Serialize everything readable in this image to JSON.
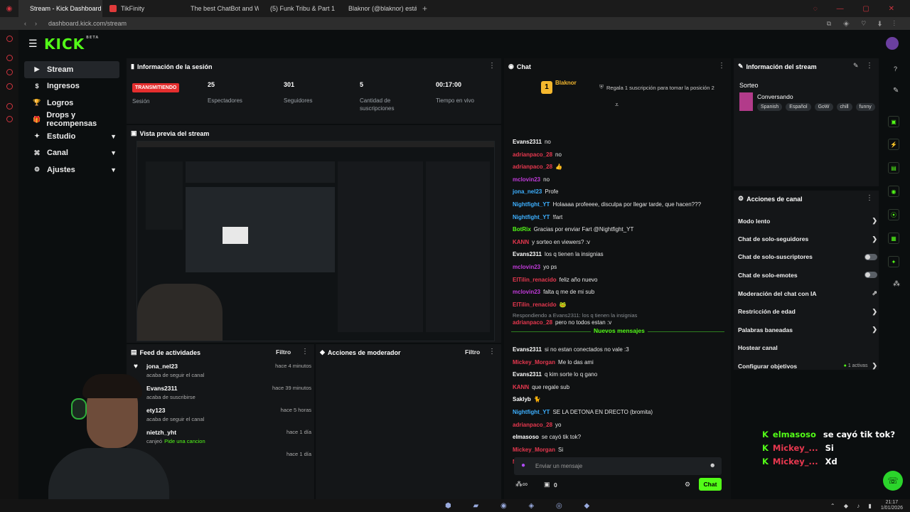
{
  "browser": {
    "tabs": [
      {
        "title": "Stream - Kick Dashboard",
        "color": "#53fc18"
      },
      {
        "title": "TikFinity",
        "color": "#e03a3a"
      },
      {
        "title": "The best ChatBot and Wi",
        "color": "#ffffff"
      },
      {
        "title": "(5) Funk Tribu & Part 1",
        "color": "#e52e2e"
      },
      {
        "title": "Blaknor (@blaknor) está e",
        "color": "#ffffff"
      }
    ],
    "url": "dashboard.kick.com/stream",
    "clock_time": "21:17",
    "clock_date": "1/01/2026"
  },
  "app": {
    "logo": "KICK",
    "logo_sup": "BETA",
    "nav": [
      {
        "label": "Stream",
        "icon": "play-icon",
        "glyph": "▶",
        "chev": ""
      },
      {
        "label": "Ingresos",
        "icon": "dollar-icon",
        "glyph": "$",
        "chev": ""
      },
      {
        "label": "Logros",
        "icon": "trophy-icon",
        "glyph": "🏆",
        "chev": ""
      },
      {
        "label": "Drops y recompensas",
        "icon": "gift-icon",
        "glyph": "🎁",
        "chev": ""
      },
      {
        "label": "Estudio",
        "icon": "studio-icon",
        "glyph": "✦",
        "chev": "▼"
      },
      {
        "label": "Canal",
        "icon": "channel-icon",
        "glyph": "⌘",
        "chev": "▼"
      },
      {
        "label": "Ajustes",
        "icon": "gear-icon",
        "glyph": "⚙",
        "chev": "▼"
      }
    ]
  },
  "session": {
    "title": "Información de la sesión",
    "status": "TRANSMITIENDO",
    "status_label": "Sesión",
    "stats": [
      {
        "value": "25",
        "label": "Espectadores"
      },
      {
        "value": "301",
        "label": "Seguidores"
      },
      {
        "value": "5",
        "label": "Cantidad de suscripciones"
      },
      {
        "value": "00:17:00",
        "label": "Tiempo en vivo"
      }
    ]
  },
  "preview": {
    "title": "Vista previa del stream"
  },
  "feed": {
    "title": "Feed de actividades",
    "filter": "Filtro",
    "items": [
      {
        "user": "jona_nel23",
        "action": "acaba de seguir el canal",
        "time": "hace 4 minutos"
      },
      {
        "user": "Evans2311",
        "action": "acaba de suscribirse",
        "time": "hace 39 minutos"
      },
      {
        "user": "ety123",
        "action": "acaba de seguir el canal",
        "time": "hace 5 horas"
      },
      {
        "user": "nietzh_yht",
        "action": "canjeó",
        "highlight": "Pide una cancion",
        "time": "hace 1 día"
      },
      {
        "user": "",
        "action": "",
        "time": "hace 1 día"
      }
    ]
  },
  "moderator": {
    "title": "Acciones de moderador",
    "filter": "Filtro"
  },
  "chat": {
    "title": "Chat",
    "pinned_user": "Blaknor",
    "pinned_rank": "1",
    "pinned_msg": "Regala 1 suscripción para tomar la posición 2",
    "messages": [
      {
        "user": "Evans2311",
        "color": "#ffffff",
        "text": "no"
      },
      {
        "user": "adrianpaco_28",
        "color": "#e8384f",
        "text": "no"
      },
      {
        "user": "adrianpaco_28",
        "color": "#e8384f",
        "text": "👍"
      },
      {
        "user": "mclovin23",
        "color": "#c23bdb",
        "text": "no"
      },
      {
        "user": "jona_nel23",
        "color": "#3db0ff",
        "text": "Profe"
      },
      {
        "user": "Nightfight_YT",
        "color": "#3db0ff",
        "text": "Holaaaa profeeee, disculpa por llegar tarde, que hacen???"
      },
      {
        "user": "Nightfight_YT",
        "color": "#3db0ff",
        "text": "!fart"
      },
      {
        "user": "BotRix",
        "color": "#53fc18",
        "text": "Gracias por enviar Fart @Nightfight_YT"
      },
      {
        "user": "KANN",
        "color": "#e8384f",
        "text": "y sorteo en viewers? :v"
      },
      {
        "user": "Evans2311",
        "color": "#ffffff",
        "text": "los q tienen la insignias"
      },
      {
        "user": "mclovin23",
        "color": "#c23bdb",
        "text": "yo ps"
      },
      {
        "user": "ElTilin_renacido",
        "color": "#e8384f",
        "text": "feliz año nuevo"
      },
      {
        "user": "mclovin23",
        "color": "#c23bdb",
        "text": "falta q me de mi sub"
      },
      {
        "user": "ElTilin_renacido",
        "color": "#e8384f",
        "text": "🐸"
      }
    ],
    "reply_to": "Respondiendo a Evans2311: los q tienen la insignias",
    "reply_msg": {
      "user": "adrianpaco_28",
      "color": "#e8384f",
      "text": "pero no todos estan :v"
    },
    "new_messages": "Nuevos mensajes",
    "messages2": [
      {
        "user": "Evans2311",
        "color": "#ffffff",
        "text": "si no estan conectados no vale :3"
      },
      {
        "user": "Mickey_Morgan",
        "color": "#e8384f",
        "text": "Me lo das ami"
      },
      {
        "user": "Evans2311",
        "color": "#ffffff",
        "text": "q kim sorte lo q gano"
      },
      {
        "user": "KANN",
        "color": "#e8384f",
        "text": "que regale sub"
      },
      {
        "user": "Saklyb",
        "color": "#ffffff",
        "text": "🐈"
      },
      {
        "user": "Nightfight_YT",
        "color": "#3db0ff",
        "text": "SE LA DETONA EN DRECTO (bromita)"
      },
      {
        "user": "adrianpaco_28",
        "color": "#e8384f",
        "text": "yo"
      },
      {
        "user": "elmasoso",
        "color": "#ffffff",
        "text": "se cayó tik tok?"
      },
      {
        "user": "Mickey_Morgan",
        "color": "#e8384f",
        "text": "Si"
      },
      {
        "user": "Mickey_Morgan",
        "color": "#e8384f",
        "text": "Xd"
      }
    ],
    "input_placeholder": "Enviar un mensaje",
    "points": "0",
    "send_label": "Chat"
  },
  "stream_info": {
    "title": "Información del stream",
    "stream_title": "Sorteo",
    "category": "Conversando",
    "tags": [
      "Spanish",
      "Español",
      "GoW",
      "chill",
      "funny"
    ]
  },
  "channel_actions": {
    "title": "Acciones de canal",
    "items": [
      {
        "label": "Modo lento",
        "kind": "chev"
      },
      {
        "label": "Chat de solo-seguidores",
        "kind": "chev"
      },
      {
        "label": "Chat de solo-suscriptores",
        "kind": "toggle"
      },
      {
        "label": "Chat de solo-emotes",
        "kind": "toggle"
      },
      {
        "label": "Moderación del chat con IA",
        "kind": "ext"
      },
      {
        "label": "Restricción de edad",
        "kind": "chev"
      },
      {
        "label": "Palabras baneadas",
        "kind": "chev"
      },
      {
        "label": "Hostear canal",
        "kind": "none"
      },
      {
        "label": "Configurar objetivos",
        "kind": "chev",
        "extra": "1 activas"
      }
    ]
  },
  "overlay": [
    {
      "user": "elmasoso",
      "color": "#53fc18",
      "text": "se cayó tik tok?"
    },
    {
      "user": "Mickey_...",
      "color": "#e8384f",
      "text": "Si"
    },
    {
      "user": "Mickey_...",
      "color": "#e8384f",
      "text": "Xd"
    }
  ],
  "colors": {
    "accent": "#53fc18",
    "live": "#e52e2e",
    "panel": "#141618",
    "bg": "#0b0e0f"
  }
}
